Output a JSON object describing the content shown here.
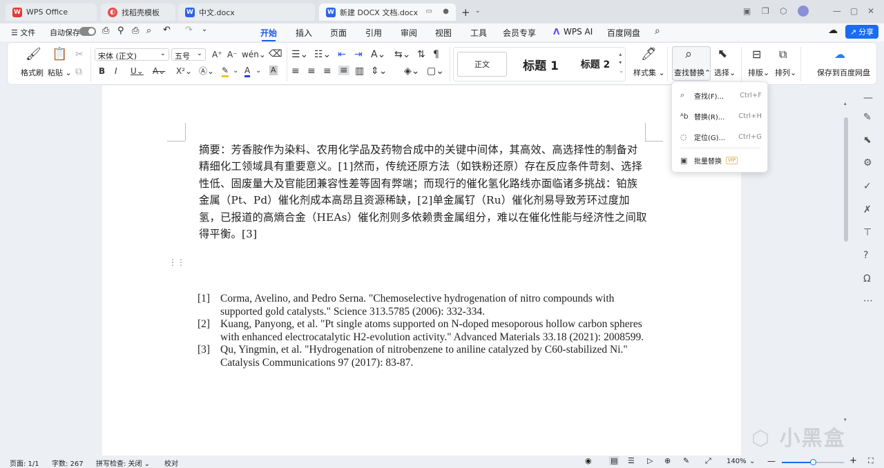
{
  "tabs": [
    {
      "label": "WPS Office",
      "glyph": "W"
    },
    {
      "label": "找稻壳模板",
      "glyph": "◐"
    },
    {
      "label": "中文.docx",
      "glyph": "W"
    },
    {
      "label": "新建 DOCX 文档.docx",
      "glyph": "W"
    }
  ],
  "window": {
    "dot": "●",
    "close": "✕"
  },
  "menu": {
    "file": "☰ 文件",
    "autosave": "自动保存",
    "tabs": [
      "开始",
      "插入",
      "页面",
      "引用",
      "审阅",
      "视图",
      "工具",
      "会员专享",
      "WPS AI",
      "百度网盘"
    ],
    "share": "分享"
  },
  "ribbon": {
    "format_painter": "格式刷",
    "paste": "粘贴",
    "font_name": "宋体 (正文)",
    "font_size": "五号",
    "styles": {
      "normal": "正文",
      "h1": "标题 1",
      "h2": "标题 2"
    },
    "style_set": "样式集",
    "find_replace": "查找替换",
    "select": "选择",
    "layout": "排版",
    "arrange": "排列",
    "save_baidu": "保存到百度网盘"
  },
  "dropdown": {
    "items": [
      {
        "label": "查找(F)...",
        "shortcut": "Ctrl+F",
        "icon": "search-icon"
      },
      {
        "label": "替换(R)...",
        "shortcut": "Ctrl+H",
        "icon": "replace-icon"
      },
      {
        "label": "定位(G)...",
        "shortcut": "Ctrl+G",
        "icon": "locate-icon"
      },
      {
        "label": "批量替换",
        "shortcut": "",
        "icon": "batch-replace-icon"
      }
    ],
    "vip": "VIP"
  },
  "document": {
    "abstract": "摘要：芳香胺作为染料、农用化学品及药物合成中的关键中间体，其高效、高选择性的制备对精细化工领域具有重要意义。[1]然而，传统还原方法（如铁粉还原）存在反应条件苛刻、选择性低、固废量大及官能团兼容性差等固有弊端；而现行的催化氢化路线亦面临诸多挑战：铂族金属（Pt、Pd）催化剂成本高昂且资源稀缺，[2]单金属钌（Ru）催化剂易导致芳环过度加氢，已报道的高熵合金（HEAs）催化剂则多依赖贵金属组分，难以在催化性能与经济性之间取得平衡。[3]",
    "references": [
      {
        "num": "[1]",
        "text": "Corma, Avelino, and Pedro Serna. \"Chemoselective hydrogenation of nitro compounds with supported gold catalysts.\" Science 313.5785 (2006): 332-334."
      },
      {
        "num": "[2]",
        "text": "Kuang, Panyong, et al. \"Pt single atoms supported on N-doped mesoporous hollow carbon spheres with enhanced electrocatalytic H2-evolution activity.\" Advanced Materials 33.18 (2021): 2008599."
      },
      {
        "num": "[3]",
        "text": "Qu, Yingmin, et al. \"Hydrogenation of nitrobenzene to aniline catalyzed by C60-stabilized Ni.\" Catalysis Communications 97 (2017): 83-87."
      }
    ]
  },
  "status": {
    "page": "页面: 1/1",
    "words": "字数: 267",
    "spell": "拼写检查: 关闭",
    "proof": "校对",
    "zoom": "140%",
    "zoom_level": 0.5
  },
  "watermark": "小黑盒",
  "colors": {
    "accent": "#1a59e6",
    "share": "#1a6cf0",
    "highlight": "#f0c419",
    "font_color": "#1a3ee6"
  }
}
